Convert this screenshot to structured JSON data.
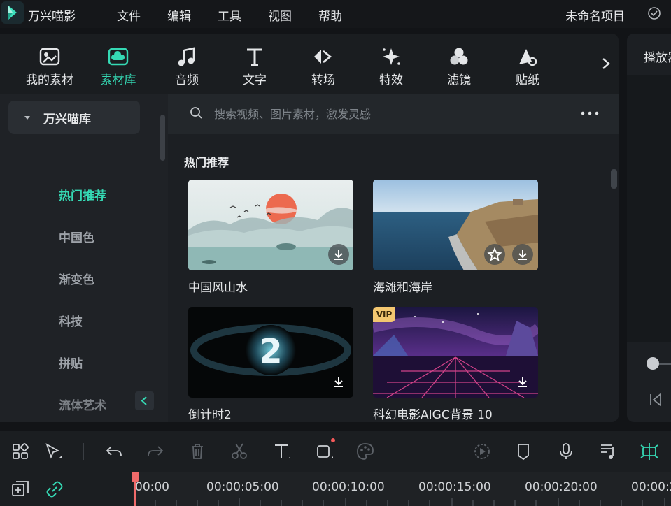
{
  "app": {
    "name": "万兴喵影",
    "project_name": "未命名项目"
  },
  "menu": [
    "文件",
    "编辑",
    "工具",
    "视图",
    "帮助"
  ],
  "toolbar": {
    "tabs": [
      {
        "label": "我的素材",
        "icon": "my-media-icon",
        "active": false
      },
      {
        "label": "素材库",
        "icon": "cloud-library-icon",
        "active": true
      },
      {
        "label": "音频",
        "icon": "music-note-icon",
        "active": false
      },
      {
        "label": "文字",
        "icon": "text-icon",
        "active": false
      },
      {
        "label": "转场",
        "icon": "transition-icon",
        "active": false
      },
      {
        "label": "特效",
        "icon": "sparkle-icon",
        "active": false
      },
      {
        "label": "滤镜",
        "icon": "filter-icon",
        "active": false
      },
      {
        "label": "贴纸",
        "icon": "sticker-icon",
        "active": false
      }
    ]
  },
  "sidebar": {
    "category": "万兴喵库",
    "items": [
      {
        "label": "热门推荐",
        "active": true
      },
      {
        "label": "中国色",
        "active": false
      },
      {
        "label": "渐变色",
        "active": false
      },
      {
        "label": "科技",
        "active": false
      },
      {
        "label": "拼贴",
        "active": false
      },
      {
        "label": "流体艺术",
        "active": false
      }
    ]
  },
  "search": {
    "placeholder": "搜索视频、图片素材，激发灵感"
  },
  "content": {
    "section_title": "热门推荐",
    "cards": [
      {
        "name": "中国风山水",
        "vip": false,
        "favorite": false
      },
      {
        "name": "海滩和海岸",
        "vip": false,
        "favorite": true
      },
      {
        "name": "倒计时2",
        "vip": false,
        "favorite": false
      },
      {
        "name": "科幻电影AIGC背景 10",
        "vip": true,
        "vip_label": "VIP",
        "favorite": false
      }
    ]
  },
  "preview": {
    "title": "播放器"
  },
  "timeline": {
    "ticks": [
      "00:00",
      "00:00:05:00",
      "00:00:10:00",
      "00:00:15:00",
      "00:00:20:00",
      "00:00:2"
    ]
  },
  "colors": {
    "accent": "#35d9b4",
    "playhead": "#f06a6a",
    "vip": "#f3c770"
  }
}
